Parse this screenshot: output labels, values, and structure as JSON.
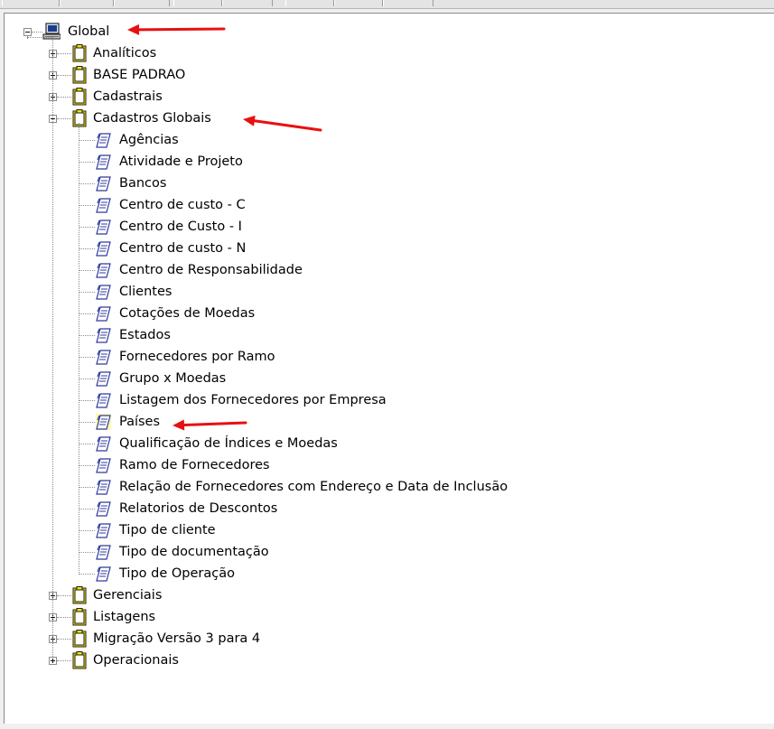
{
  "tree": {
    "root": {
      "label": "Global",
      "icon": "computer-icon",
      "expanded": true
    },
    "folders": [
      {
        "label": "Analíticos",
        "expanded": false
      },
      {
        "label": "BASE PADRAO",
        "expanded": false
      },
      {
        "label": "Cadastrais",
        "expanded": false
      },
      {
        "label": "Cadastros Globais",
        "expanded": true,
        "children": [
          "Agências",
          "Atividade e Projeto",
          "Bancos",
          "Centro de custo - C",
          "Centro de Custo - I",
          "Centro de custo - N",
          "Centro de Responsabilidade",
          "Clientes",
          "Cotações de Moedas",
          "Estados",
          "Fornecedores por Ramo",
          "Grupo x Moedas",
          "Listagem dos Fornecedores por Empresa",
          "Países",
          "Qualificação de Índices e Moedas",
          "Ramo de Fornecedores",
          "Relação de Fornecedores com Endereço e Data de Inclusão",
          "Relatorios de Descontos",
          "Tipo de cliente",
          "Tipo de documentação",
          "Tipo de Operação"
        ]
      },
      {
        "label": "Gerenciais",
        "expanded": false
      },
      {
        "label": "Listagens",
        "expanded": false
      },
      {
        "label": "Migração Versão 3 para 4",
        "expanded": false
      },
      {
        "label": "Operacionais",
        "expanded": false
      }
    ]
  },
  "icons": {
    "folder": "clipboard-folder-icon",
    "report": "report-sheet-icon",
    "root": "computer-icon"
  },
  "colors": {
    "annotation_arrow": "#e81010",
    "folder_yellow": "#f5e600"
  }
}
